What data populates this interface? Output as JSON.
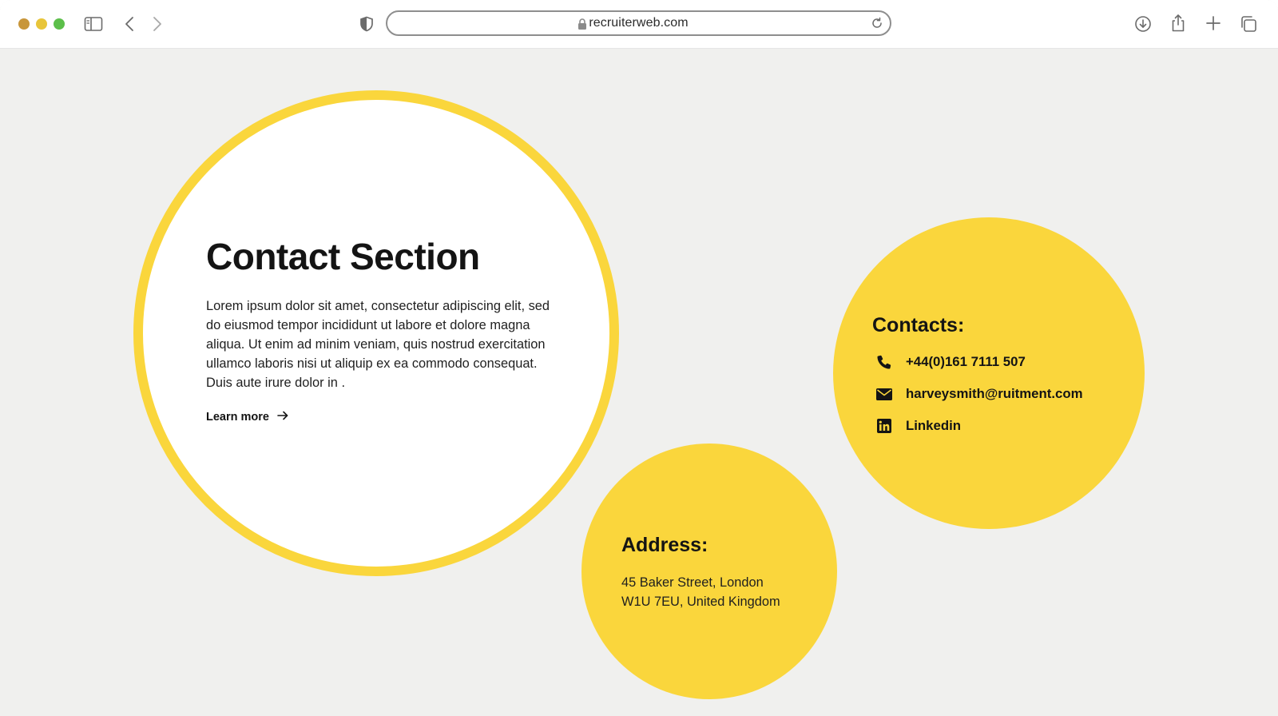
{
  "browser": {
    "url": "recruiterweb.com",
    "traffic_colors": {
      "close": "#c8963a",
      "minimize": "#e8c53a",
      "zoom": "#5cbf4a"
    }
  },
  "colors": {
    "accent": "#fad63c",
    "background": "#f0f0ee",
    "text": "#141414"
  },
  "hero": {
    "title": "Contact Section",
    "body": "Lorem ipsum dolor sit amet, consectetur adipiscing elit, sed do eiusmod tempor incididunt ut labore et dolore magna aliqua. Ut enim ad minim veniam, quis nostrud exercitation ullamco laboris nisi ut aliquip ex ea commodo consequat. Duis aute irure dolor in .",
    "learn_more": "Learn more"
  },
  "contacts": {
    "heading": "Contacts:",
    "phone": "+44(0)161 7111 507",
    "email": "harveysmith@ruitment.com",
    "linkedin": "Linkedin"
  },
  "address": {
    "heading": "Address:",
    "line1": "45 Baker Street, London",
    "line2": "W1U 7EU, United Kingdom"
  }
}
